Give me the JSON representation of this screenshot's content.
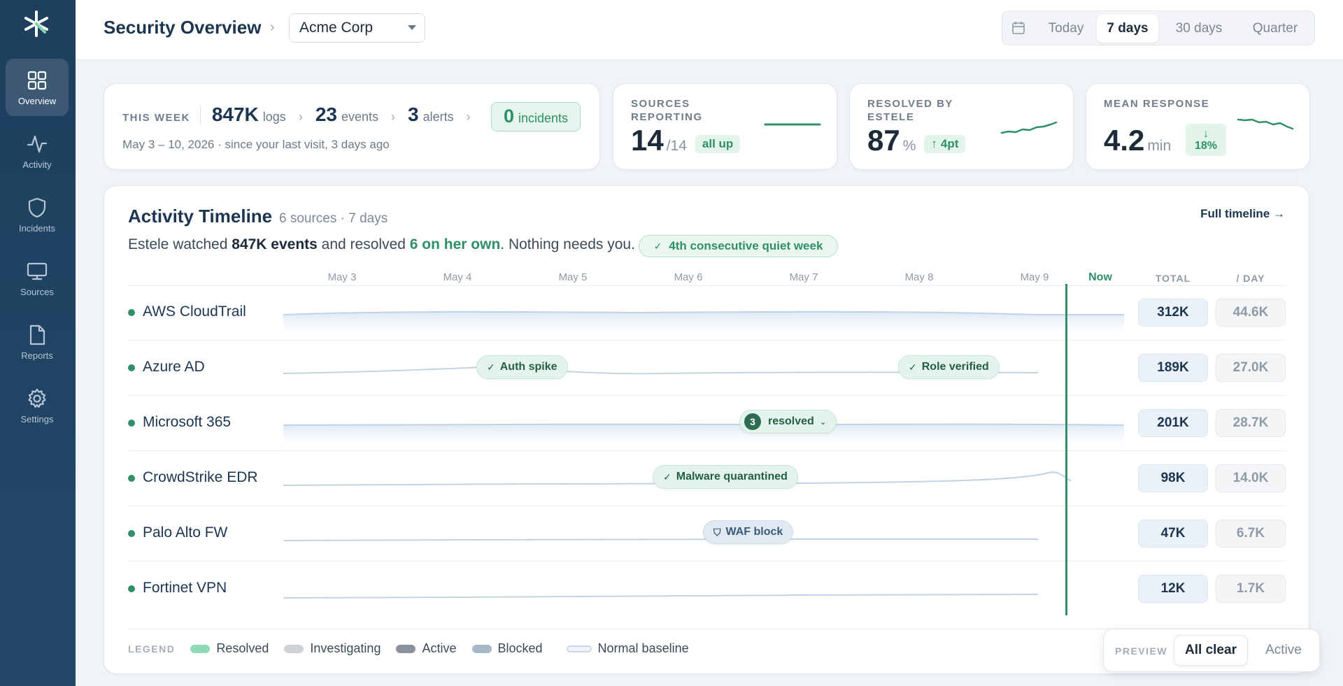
{
  "sidebar": {
    "logo": "asterisk-logo",
    "items": [
      {
        "label": "Overview",
        "icon": "grid-icon",
        "active": true
      },
      {
        "label": "Activity",
        "icon": "pulse-icon",
        "active": false
      },
      {
        "label": "Incidents",
        "icon": "shield-icon",
        "active": false
      },
      {
        "label": "Sources",
        "icon": "monitor-icon",
        "active": false
      },
      {
        "label": "Reports",
        "icon": "document-icon",
        "active": false
      },
      {
        "label": "Settings",
        "icon": "gear-icon",
        "active": false
      }
    ]
  },
  "header": {
    "title": "Security Overview",
    "separator": "›",
    "org": "Acme Corp",
    "ranges": [
      "Today",
      "7 days",
      "30 days",
      "Quarter"
    ],
    "active_range": "7 days"
  },
  "week": {
    "label": "THIS WEEK",
    "logs_value": "847K",
    "logs_unit": "logs",
    "events_value": "23",
    "events_unit": "events",
    "alerts_value": "3",
    "alerts_unit": "alerts",
    "incidents_value": "0",
    "incidents_unit": "incidents",
    "subtitle": "May 3 – 10, 2026 · since your last visit, 3 days ago"
  },
  "stats": {
    "sources": {
      "label": "SOURCES REPORTING",
      "value": "14",
      "suffix": "/14",
      "badge": "all up"
    },
    "resolved": {
      "label": "RESOLVED BY ESTELE",
      "value": "87",
      "suffix": "%",
      "badge": "4pt"
    },
    "response": {
      "label": "MEAN RESPONSE",
      "value": "4.2",
      "suffix": "min",
      "badge": "18%"
    }
  },
  "timeline": {
    "title": "Activity Timeline",
    "meta": "6 sources · 7 days",
    "full_link": "Full timeline →",
    "summary_pre": "Estele watched ",
    "summary_events": "847K events",
    "summary_mid": " and resolved ",
    "summary_own": "6 on her own",
    "summary_post": ". Nothing needs you.",
    "quiet_badge": "4th consecutive quiet week",
    "days": [
      "May 3",
      "May 4",
      "May 5",
      "May 6",
      "May 7",
      "May 8",
      "May 9"
    ],
    "now_label": "Now",
    "col_total": "TOTAL",
    "col_day": "/ DAY",
    "rows": [
      {
        "name": "AWS CloudTrail",
        "total": "312K",
        "per_day": "44.6K"
      },
      {
        "name": "Azure AD",
        "total": "189K",
        "per_day": "27.0K"
      },
      {
        "name": "Microsoft 365",
        "total": "201K",
        "per_day": "28.7K"
      },
      {
        "name": "CrowdStrike EDR",
        "total": "98K",
        "per_day": "14.0K"
      },
      {
        "name": "Palo Alto FW",
        "total": "47K",
        "per_day": "6.7K"
      },
      {
        "name": "Fortinet VPN",
        "total": "12K",
        "per_day": "1.7K"
      }
    ],
    "chips": {
      "auth_spike": "Auth spike",
      "role_verified": "Role verified",
      "resolved_count": "3",
      "resolved_label": "resolved",
      "malware": "Malware quarantined",
      "waf": "WAF block"
    },
    "legend": {
      "label": "LEGEND",
      "items": [
        {
          "label": "Resolved",
          "color": "#8fd9b6"
        },
        {
          "label": "Investigating",
          "color": "#cdd2d8"
        },
        {
          "label": "Active",
          "color": "#8a939d"
        },
        {
          "label": "Blocked",
          "color": "#a9b8c8"
        },
        {
          "label": "Normal baseline",
          "color": "#e6eef7"
        }
      ]
    }
  },
  "preview": {
    "label": "PREVIEW",
    "options": [
      "All clear",
      "Active"
    ],
    "active": "All clear"
  },
  "colors": {
    "accent": "#2f8f66",
    "sidebar": "#1e3f5e",
    "text_dark": "#1c3550"
  }
}
